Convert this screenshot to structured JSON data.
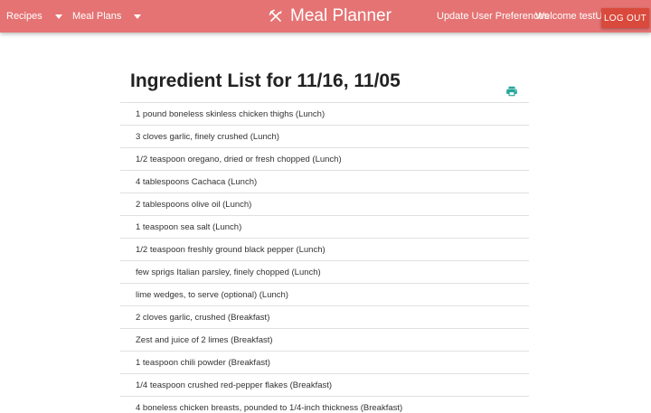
{
  "header": {
    "recipes_label": "Recipes",
    "meal_plans_label": "Meal Plans",
    "app_title": "Meal Planner",
    "prefs_label": "Update User Preferences",
    "welcome_label": "Welcome testUser",
    "logout_label": "LOG OUT",
    "logo_icon": "fork-knife-icon"
  },
  "main": {
    "title": "Ingredient List for 11/16, 11/05",
    "print_icon": "print-icon",
    "ingredients": [
      "1 pound boneless skinless chicken thighs (Lunch)",
      "3 cloves garlic, finely crushed (Lunch)",
      "1/2 teaspoon oregano, dried or fresh chopped (Lunch)",
      "4 tablespoons Cachaca (Lunch)",
      "2 tablespoons olive oil (Lunch)",
      "1 teaspoon sea salt (Lunch)",
      "1/2 teaspoon freshly ground black pepper (Lunch)",
      "few sprigs Italian parsley, finely chopped (Lunch)",
      "lime wedges, to serve (optional) (Lunch)",
      "2 cloves garlic, crushed (Breakfast)",
      "Zest and juice of 2 limes (Breakfast)",
      "1 teaspoon chili powder (Breakfast)",
      "1/4 teaspoon crushed red-pepper flakes (Breakfast)",
      "4 boneless chicken breasts, pounded to 1/4-inch thickness (Breakfast)"
    ]
  },
  "colors": {
    "header_bg": "#e57373",
    "logout_bg": "#d94a3c",
    "print_icon": "#26a69a"
  }
}
